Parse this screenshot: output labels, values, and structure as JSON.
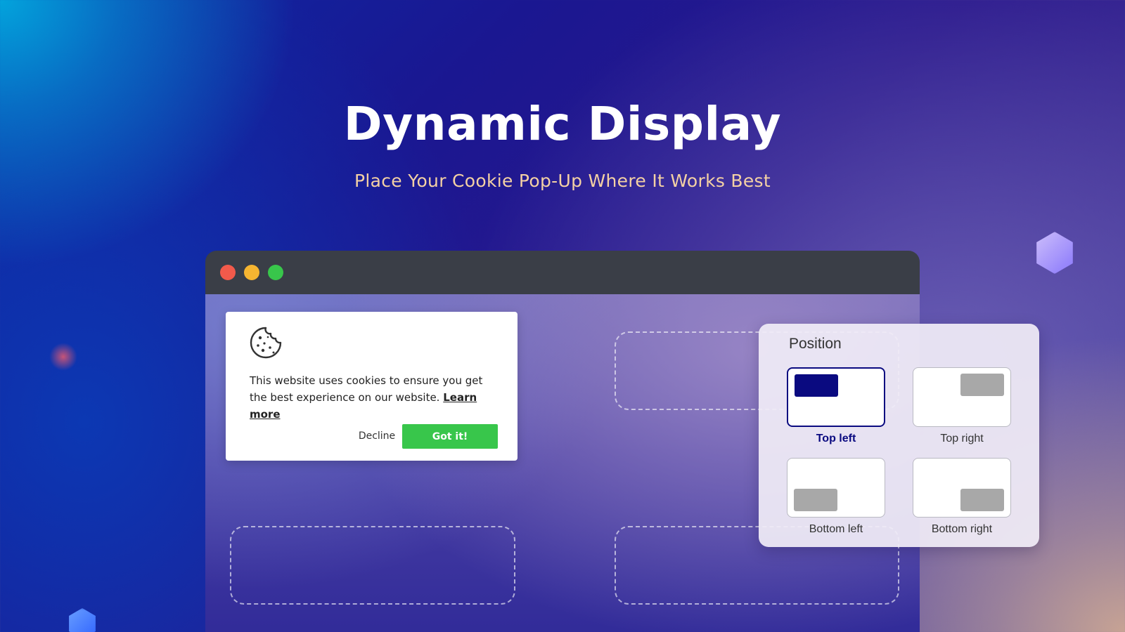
{
  "hero": {
    "title": "Dynamic Display",
    "subtitle": "Place Your Cookie Pop-Up Where It Works Best"
  },
  "browser": {
    "controls": [
      "close",
      "minimize",
      "maximize"
    ]
  },
  "cookie_popup": {
    "icon": "cookie-icon",
    "message": "This website uses cookies to ensure you get the best experience on our website.",
    "link_label": "Learn more",
    "decline_label": "Decline",
    "accept_label": "Got it!",
    "accept_color": "#38c64b"
  },
  "position_panel": {
    "title": "Position",
    "selected": "Top left",
    "options": [
      {
        "label": "Top left",
        "selected": true
      },
      {
        "label": "Top right",
        "selected": false
      },
      {
        "label": "Bottom left",
        "selected": false
      },
      {
        "label": "Bottom right",
        "selected": false
      }
    ],
    "selected_color": "#0a0a80",
    "unselected_color": "#a8a8a8"
  }
}
